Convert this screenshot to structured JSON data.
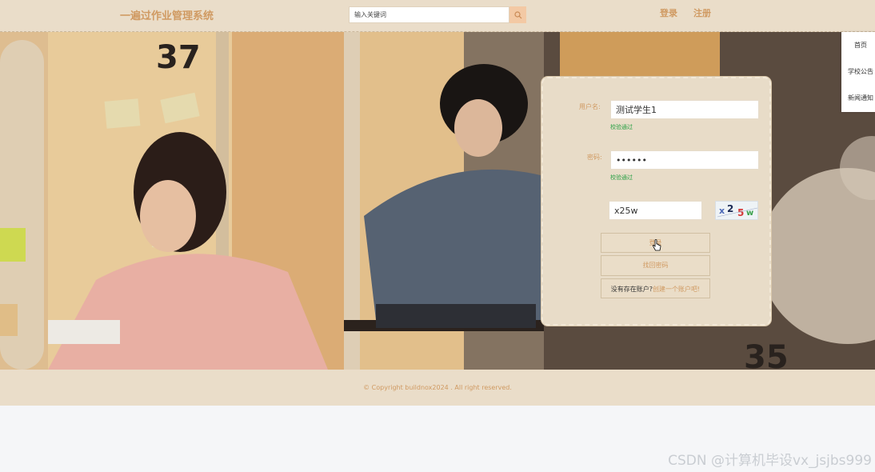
{
  "header": {
    "site_title": "一遍过作业管理系统",
    "search_placeholder": "输入关键词",
    "login_link": "登录",
    "register_link": "注册"
  },
  "sidenav": {
    "items": [
      {
        "label": "首页"
      },
      {
        "label": "学校公告"
      },
      {
        "label": "新闻通知"
      }
    ]
  },
  "login_form": {
    "username_label": "用户名:",
    "username_value": "测试学生1",
    "username_hint": "校验通过",
    "password_label": "密码:",
    "password_value": "••••••",
    "password_hint": "校验通过",
    "captcha_value": "x25w",
    "captcha_image_text": "x2 5 w",
    "login_button": "登录",
    "forgot_button": "找回密码",
    "register_question": "没有存在账户?",
    "register_action": "创建一个账户吧!"
  },
  "footer": {
    "copyright": "© Copyright buildnox2024 . All right reserved."
  },
  "watermark": "CSDN @计算机毕设vx_jsjbs999",
  "colors": {
    "accent": "#d09a62",
    "bar_bg": "#eaddc9",
    "success": "#2aa145"
  }
}
